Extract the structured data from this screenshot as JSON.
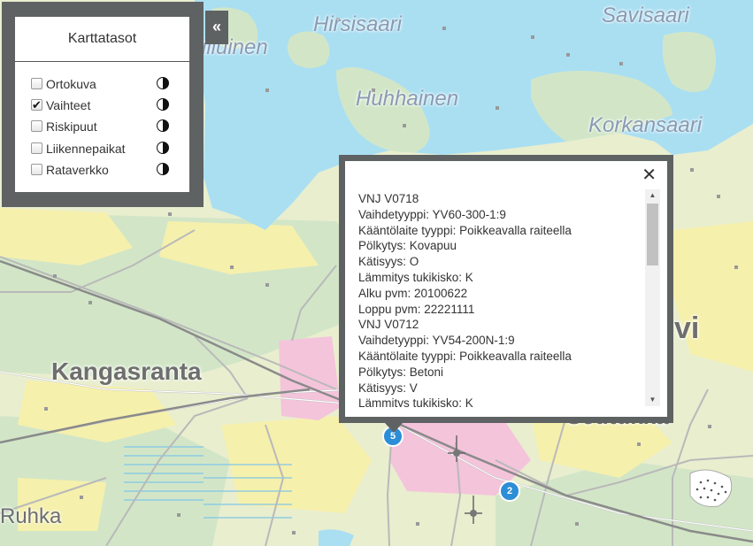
{
  "map": {
    "labels": {
      "hirsisaari": "Hirsisaari",
      "savisaari": "Savisaari",
      "kiiluinen": "Kiiluinen",
      "huhhainen": "Huhhainen",
      "korkansaari": "Korkansaari",
      "kangasranta": "Kangasranta",
      "ruhka": "Ruhka",
      "seutukka": "Seutukkä",
      "vi": "vi"
    },
    "clusters": [
      {
        "count": "5"
      },
      {
        "count": "2"
      }
    ],
    "colors": {
      "water": "#aadff2",
      "land": "#e9eecf",
      "forest": "#cfe8c9",
      "field": "#f7f2ac",
      "urban": "#f5c6dc",
      "cluster": "#2b8ed6"
    }
  },
  "layer_panel": {
    "title": "Karttatasot",
    "collapse_icon": "«",
    "layers": [
      {
        "label": "Ortokuva",
        "checked": false
      },
      {
        "label": "Vaihteet",
        "checked": true
      },
      {
        "label": "Riskipuut",
        "checked": false
      },
      {
        "label": "Liikennepaikat",
        "checked": false
      },
      {
        "label": "Rataverkko",
        "checked": false
      }
    ]
  },
  "popup": {
    "close_icon": "✕",
    "lines": [
      "VNJ V0718",
      "Vaihdetyyppi: YV60-300-1:9",
      "Kääntölaite tyyppi: Poikkeavalla raiteella",
      "Pölkytys: Kovapuu",
      "Kätisyys: O",
      "Lämmitys tukikisko: K",
      "Alku pvm: 20100622",
      "Loppu pvm: 22221111",
      "VNJ V0712",
      "Vaihdetyyppi: YV54-200N-1:9",
      "Kääntölaite tyyppi: Poikkeavalla raiteella",
      "Pölkytys: Betoni",
      "Kätisyys: V",
      "Lämmitys tukikisko: K"
    ]
  }
}
